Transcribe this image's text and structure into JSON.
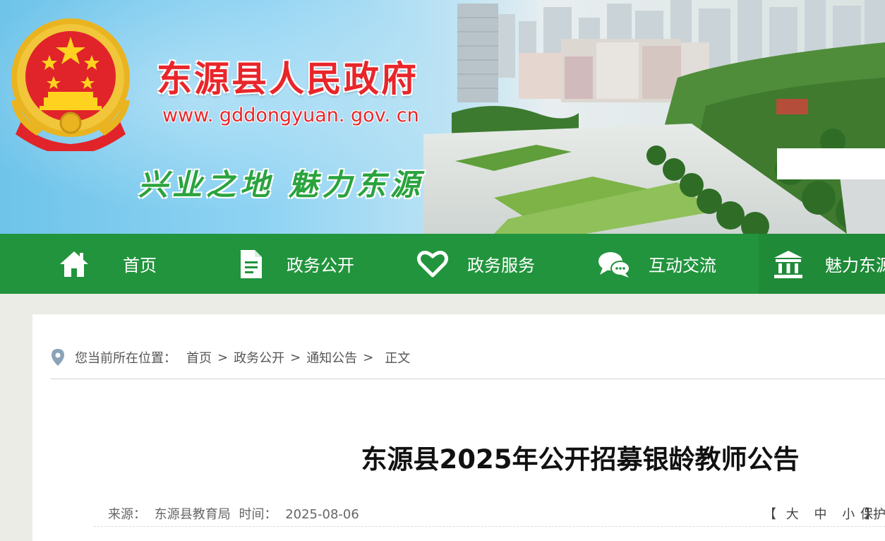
{
  "colors": {
    "nav_bg": "#22943d",
    "title_red": "#e8262a",
    "slogan_green": "#2aa33e"
  },
  "header": {
    "emblem_icon": "national-emblem-icon",
    "site_title": "东源县人民政府",
    "site_url": "www. gddongyuan. gov. cn",
    "slogan": "兴业之地  魅力东源"
  },
  "nav": {
    "items": [
      {
        "label": "首页",
        "icon": "home-icon"
      },
      {
        "label": "政务公开",
        "icon": "document-icon"
      },
      {
        "label": "政务服务",
        "icon": "heart-icon"
      },
      {
        "label": "互动交流",
        "icon": "chat-icon"
      },
      {
        "label": "魅力东源",
        "icon": "building-icon"
      }
    ]
  },
  "breadcrumb": {
    "prefix": "您当前所在位置：",
    "items": [
      "首页",
      "政务公开",
      "通知公告"
    ],
    "current": "正文"
  },
  "article": {
    "title": "东源县2025年公开招募银龄教师公告",
    "source_label": "来源：",
    "source": "东源县教育局",
    "time_label": "时间：",
    "time": "2025-08-06",
    "font_size": {
      "open": "【",
      "large": "大",
      "medium": "中",
      "small": "小",
      "close": "】"
    },
    "protect": "保护"
  }
}
